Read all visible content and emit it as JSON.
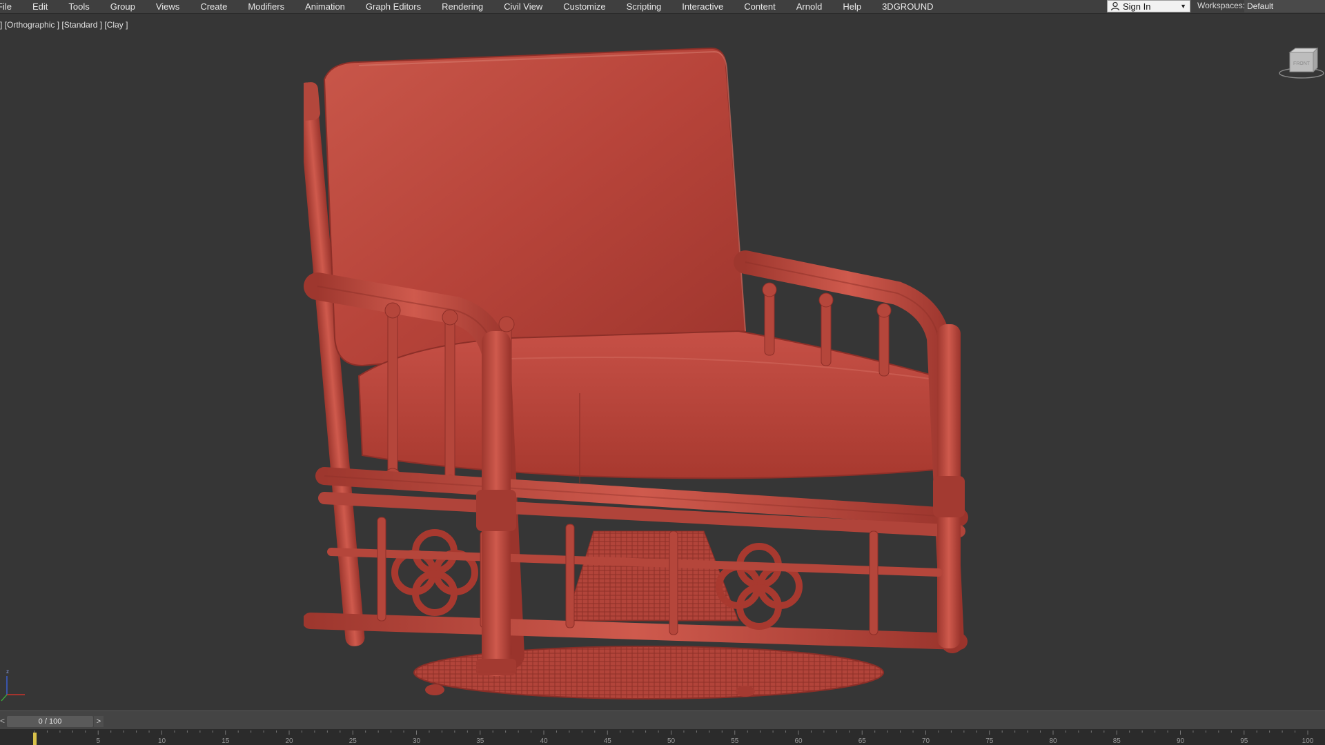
{
  "menu": {
    "items": [
      "File",
      "Edit",
      "Tools",
      "Group",
      "Views",
      "Create",
      "Modifiers",
      "Animation",
      "Graph Editors",
      "Rendering",
      "Civil View",
      "Customize",
      "Scripting",
      "Interactive",
      "Content",
      "Arnold",
      "Help",
      "3DGROUND"
    ]
  },
  "account": {
    "sign_in_label": "Sign In",
    "workspaces_label": "Workspaces:",
    "workspace_value": "Default"
  },
  "viewport": {
    "label": "] [Orthographic ] [Standard ] [Clay ]",
    "background": "#363636",
    "object_color": "#c0463a",
    "viewcube_face": "FRONT"
  },
  "timeline": {
    "current_label": "0 / 100",
    "prev_label": "<",
    "next_label": ">",
    "ticks": [
      "5",
      "10",
      "15",
      "20",
      "25",
      "30",
      "35",
      "40",
      "45",
      "50",
      "55",
      "60",
      "65",
      "70",
      "75",
      "80",
      "85",
      "90",
      "95",
      "100"
    ]
  }
}
